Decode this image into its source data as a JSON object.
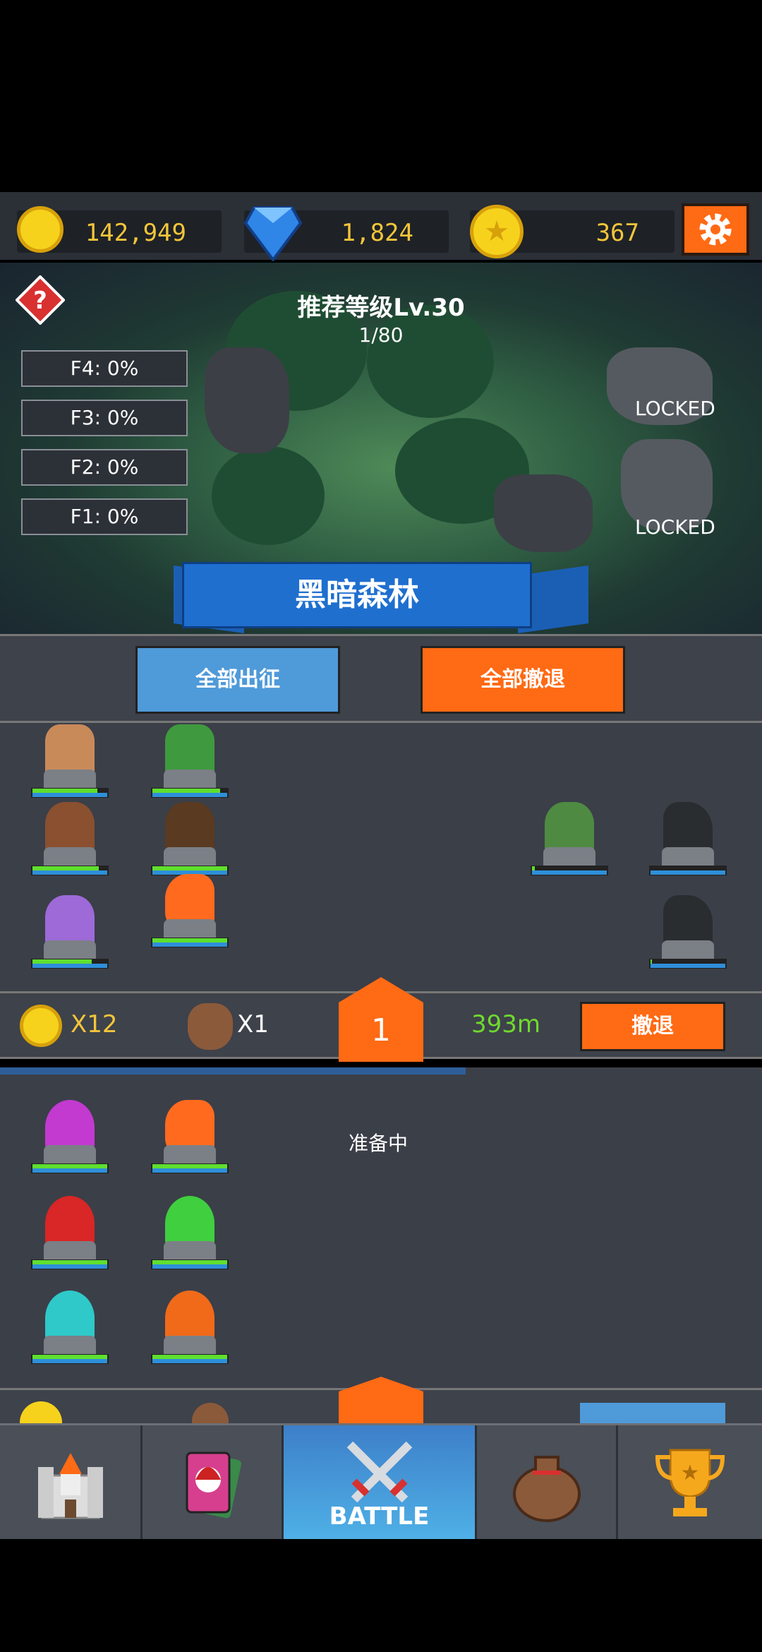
{
  "resources": {
    "gold": "142,949",
    "gems": "1,824",
    "stars": "367"
  },
  "map": {
    "recommend": "推荐等级Lv.30",
    "progress": "1/80",
    "floors": [
      "F4: 0%",
      "F3: 0%",
      "F2: 0%",
      "F1: 0%"
    ],
    "locked_1": "LOCKED",
    "locked_2": "LOCKED",
    "area_name": "黑暗森林"
  },
  "commands": {
    "deploy_all": "全部出征",
    "retreat_all": "全部撤退"
  },
  "status": {
    "coin_mult": "X12",
    "bag_mult": "X1",
    "stage": "1",
    "distance": "393m",
    "retreat": "撤退"
  },
  "team2": {
    "state": "准备中"
  },
  "nav": {
    "battle": "BATTLE"
  },
  "colors": {
    "accent_orange": "#ff6a14",
    "accent_blue": "#4f9ad9",
    "gold": "#f6d21d"
  },
  "icons": [
    "gold-coin-icon",
    "gem-icon",
    "star-coin-icon",
    "gear-icon",
    "question-icon",
    "castle-icon",
    "cards-icon",
    "swords-icon",
    "bag-icon",
    "trophy-icon"
  ]
}
